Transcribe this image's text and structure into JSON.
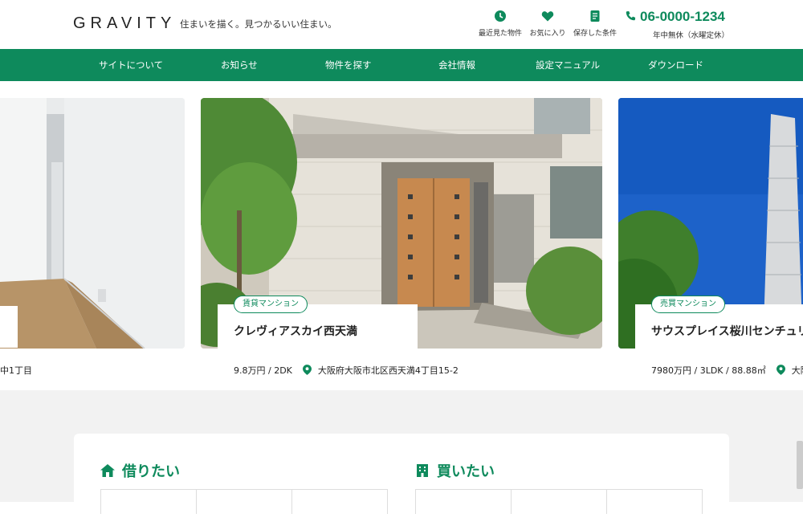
{
  "header": {
    "logo": "GRAVITY",
    "tagline": "住まいを描く。見つかるいい住まい。",
    "links": [
      {
        "label": "最近見た物件",
        "icon": "clock-icon"
      },
      {
        "label": "お気に入り",
        "icon": "heart-icon"
      },
      {
        "label": "保存した条件",
        "icon": "document-icon"
      }
    ],
    "phone": "06-0000-1234",
    "hours": "年中無休（水曜定休）"
  },
  "nav": {
    "items": [
      "サイトについて",
      "お知らせ",
      "物件を探す",
      "会社情報",
      "設定マニュアル",
      "ダウンロード"
    ]
  },
  "slider": {
    "cards": [
      {
        "title": "",
        "address_fragment": "中1丁目"
      },
      {
        "badge": "賃貸マンション",
        "title": "クレヴィアスカイ西天満",
        "price": "9.8万円 / 2DK",
        "address": "大阪府大阪市北区西天満4丁目15-2"
      },
      {
        "badge": "売買マンション",
        "title": "サウスプレイス桜川センチュリ",
        "price": "7980万円 / 3LDK / 88.88㎡",
        "address": "大阪府"
      }
    ]
  },
  "sections": {
    "rent": {
      "title": "借りたい",
      "icon": "house-icon"
    },
    "buy": {
      "title": "買いたい",
      "icon": "building-icon"
    }
  },
  "colors": {
    "accent": "#0e8a5c",
    "background_lower": "#f2f2f2"
  }
}
